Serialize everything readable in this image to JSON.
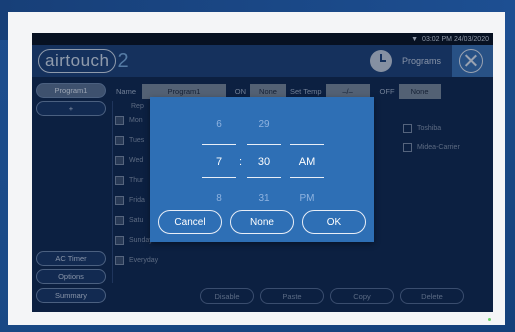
{
  "statusbar": {
    "time": "03:02 PM 24/03/2020",
    "wifi_icon": "wifi-icon"
  },
  "header": {
    "logo_main": "airtouch",
    "logo_suffix": "2",
    "page_title": "Programs"
  },
  "sidebar": {
    "program": "Program1",
    "add": "+",
    "ac_timer": "AC Timer",
    "options": "Options",
    "summary": "Summary"
  },
  "form": {
    "name_label": "Name",
    "name_value": "Program1",
    "on_label": "ON",
    "on_value": "None",
    "settemp_label": "Set Temp",
    "settemp_value": "–/–",
    "off_label": "OFF",
    "off_value": "None"
  },
  "main": {
    "repeat_label": "Rep",
    "days": [
      "Mon",
      "Tues",
      "Wed",
      "Thur",
      "Frida",
      "Satu",
      "Sunday",
      "Everyday"
    ],
    "brands": [
      "Toshiba",
      "Midea-Carrier"
    ]
  },
  "bottombar": {
    "disable": "Disable",
    "paste": "Paste",
    "copy": "Copy",
    "delete": "Delete"
  },
  "picker": {
    "hours": [
      "6",
      "7",
      "8"
    ],
    "minutes": [
      "29",
      "30",
      "31"
    ],
    "ampm": [
      "",
      "AM",
      "PM"
    ],
    "separator": ":",
    "cancel": "Cancel",
    "none": "None",
    "ok": "OK"
  },
  "colors": {
    "modal": "#2e6fb5",
    "header": "#1d3e72",
    "background": "#0e2448"
  }
}
